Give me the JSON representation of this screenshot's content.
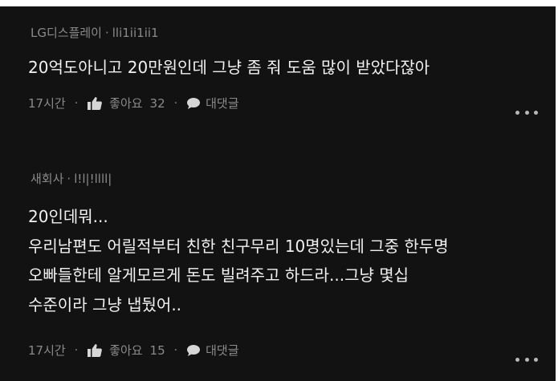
{
  "comments": [
    {
      "author": "LG디스플레이",
      "id": "lli1ii1ii1",
      "lines": [
        "20억도아니고 20만원인데 그냥 좀 줘 도움 많이 받았다잖아"
      ],
      "time": "17시간",
      "like_label": "좋아요",
      "like_count": "32",
      "reply_label": "대댓글"
    },
    {
      "author": "새회사",
      "id": "l!l|!llll|",
      "lines": [
        "20인데뭐...",
        "우리남편도 어릴적부터 친한 친구무리 10명있는데 그중 한두명",
        "오빠들한테 알게모르게 돈도 빌려주고 하드라...그냥 몇십",
        "수준이라 그냥 냅뒀어.."
      ],
      "time": "17시간",
      "like_label": "좋아요",
      "like_count": "15",
      "reply_label": "대댓글"
    }
  ],
  "separator": "·",
  "icons": {
    "like": "thumbs-up-icon",
    "reply": "speech-bubble-icon",
    "more": "more-dots-icon"
  },
  "colors": {
    "background": "#121212",
    "body_text": "#f1f1f1",
    "meta_text": "#8a8a8a"
  }
}
